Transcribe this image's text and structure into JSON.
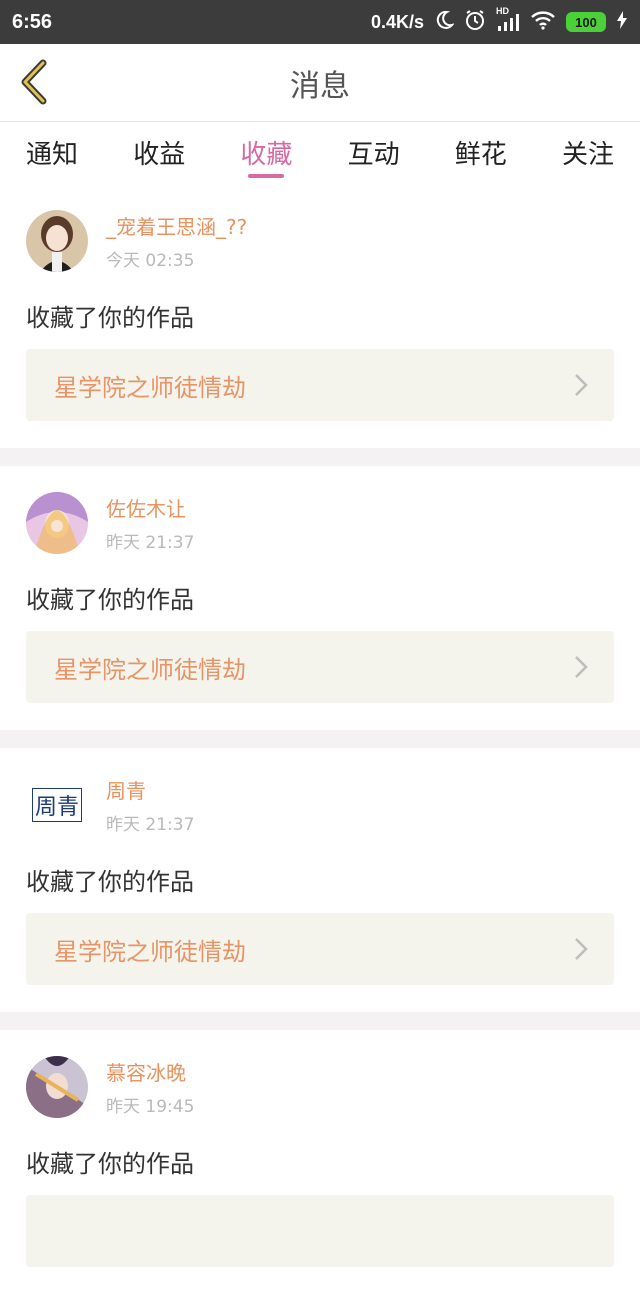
{
  "status": {
    "time": "6:56",
    "speed": "0.4K/s",
    "hd": "HD",
    "battery": "100"
  },
  "header": {
    "title": "消息"
  },
  "tabs": [
    "通知",
    "收益",
    "收藏",
    "互动",
    "鲜花",
    "关注"
  ],
  "active_tab": 2,
  "messages": [
    {
      "name": "_宠着王思涵_??",
      "time": "今天 02:35",
      "action": "收藏了你的作品",
      "work": "星学院之师徒情劫"
    },
    {
      "name": "佐佐木让",
      "time": "昨天 21:37",
      "action": "收藏了你的作品",
      "work": "星学院之师徒情劫"
    },
    {
      "name": "周青",
      "avatar_text": "周青",
      "time": "昨天 21:37",
      "action": "收藏了你的作品",
      "work": "星学院之师徒情劫"
    },
    {
      "name": "慕容冰晚",
      "time": "昨天 19:45",
      "action": "收藏了你的作品",
      "work": ""
    }
  ],
  "colors": {
    "accent": "#d86aa1",
    "name": "#e8935f",
    "work": "#e59567",
    "back": "#c9a23a"
  }
}
